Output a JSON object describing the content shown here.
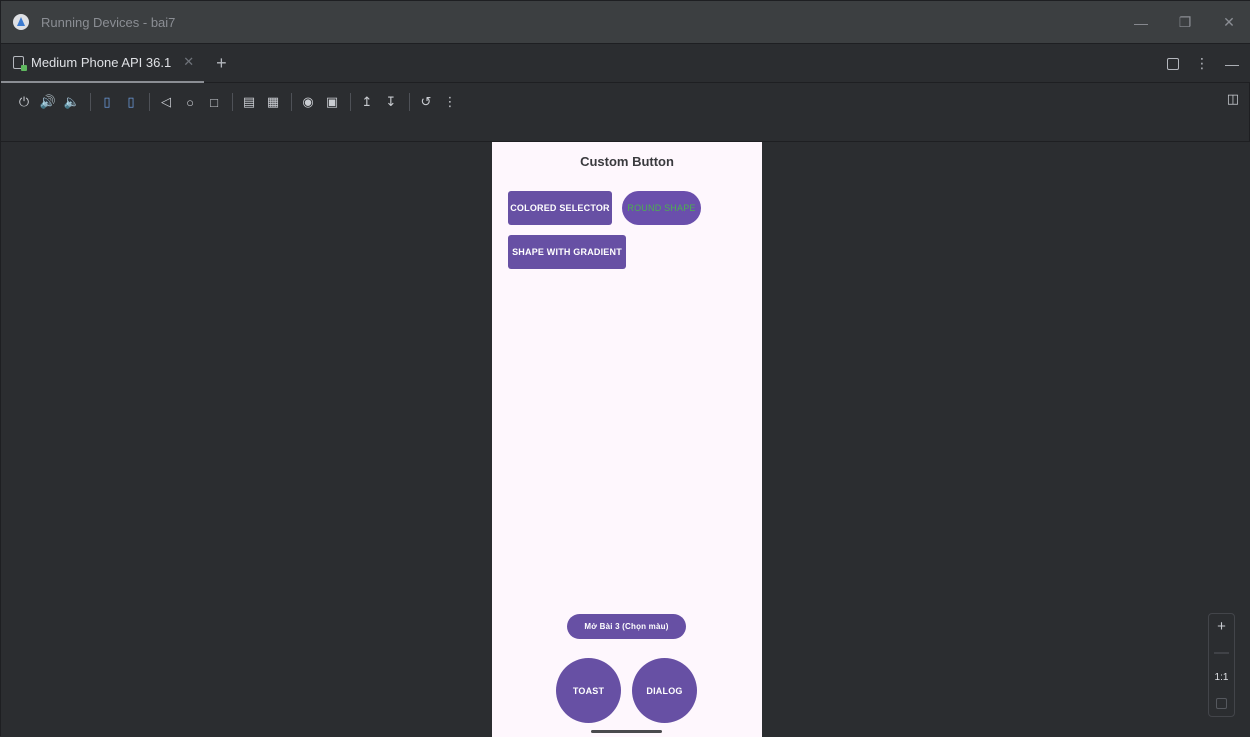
{
  "window": {
    "title": "Running Devices - bai7"
  },
  "tabs": [
    {
      "label": "Medium Phone API 36.1"
    }
  ],
  "toolbar": {
    "icons": [
      "power-icon",
      "volume-up-icon",
      "volume-down-icon",
      "rotate-left-icon",
      "rotate-right-icon",
      "back-icon",
      "home-icon",
      "overview-icon",
      "device-file-icon",
      "snapshot-icon",
      "screenshot-icon",
      "screen-record-icon",
      "upload-icon",
      "download-icon",
      "reset-icon",
      "more-icon"
    ]
  },
  "app": {
    "title": "Custom Button",
    "buttons": {
      "colored_selector": "COLORED SELECTOR",
      "round_shape": "ROUND SHAPE",
      "shape_gradient": "SHAPE WITH GRADIENT",
      "open_lesson": "Mở Bài 3 (Chọn màu)",
      "toast": "TOAST",
      "dialog": "DIALOG"
    },
    "colors": {
      "primary": "#6750a4",
      "round_shape_text": "#4caf50",
      "background": "#fef7fd"
    }
  },
  "zoom": {
    "ratio": "1:1"
  }
}
